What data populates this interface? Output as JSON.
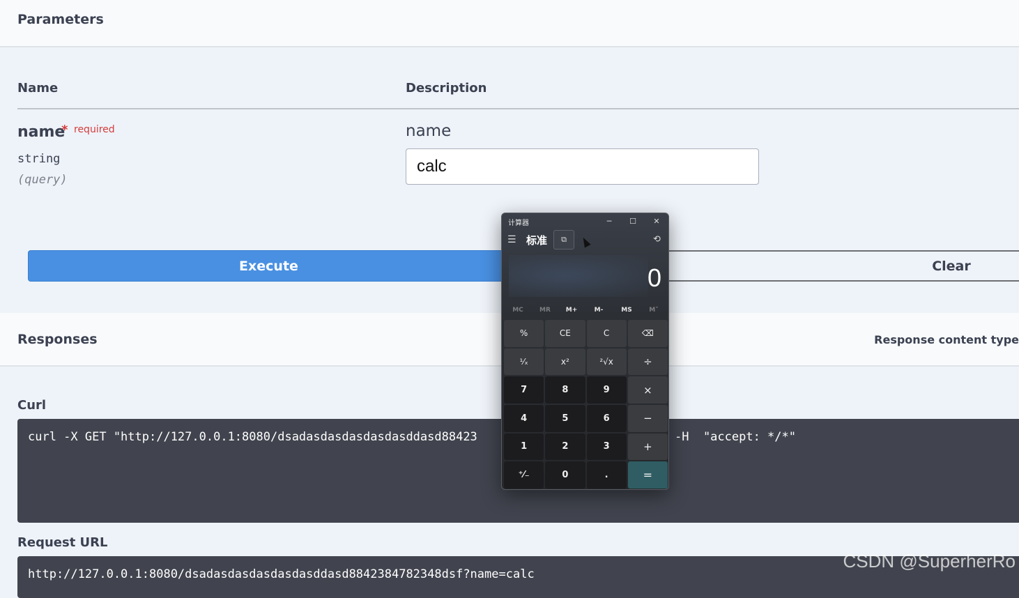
{
  "parameters": {
    "title": "Parameters",
    "col_name": "Name",
    "col_description": "Description",
    "param": {
      "name": "name",
      "required_star": "*",
      "required_text": "required",
      "type": "string",
      "in": "(query)",
      "description": "name",
      "value": "calc"
    }
  },
  "buttons": {
    "execute": "Execute",
    "clear": "Clear"
  },
  "responses": {
    "title": "Responses",
    "content_type_label": "Response content type",
    "curl_label": "Curl",
    "curl_text_left": "curl -X GET \"http://127.0.0.1:8080/dsadasdasdasdasdasddasd88423",
    "curl_text_right": "-H  \"accept: */*\"",
    "request_url_label": "Request URL",
    "request_url": "http://127.0.0.1:8080/dsadasdasdasdasdasddasd8842384782348dsf?name=calc"
  },
  "calculator": {
    "window_title": "计算器",
    "mode": "标准",
    "display": "0",
    "memory": [
      "MC",
      "MR",
      "M+",
      "M-",
      "MS",
      "M˅"
    ],
    "keys": [
      "%",
      "CE",
      "C",
      "⌫",
      "¹⁄ₓ",
      "x²",
      "²√x",
      "÷",
      "7",
      "8",
      "9",
      "×",
      "4",
      "5",
      "6",
      "−",
      "1",
      "2",
      "3",
      "+",
      "⁺⁄₋",
      "0",
      ".",
      "="
    ]
  },
  "watermark": "CSDN @SuperherRo"
}
